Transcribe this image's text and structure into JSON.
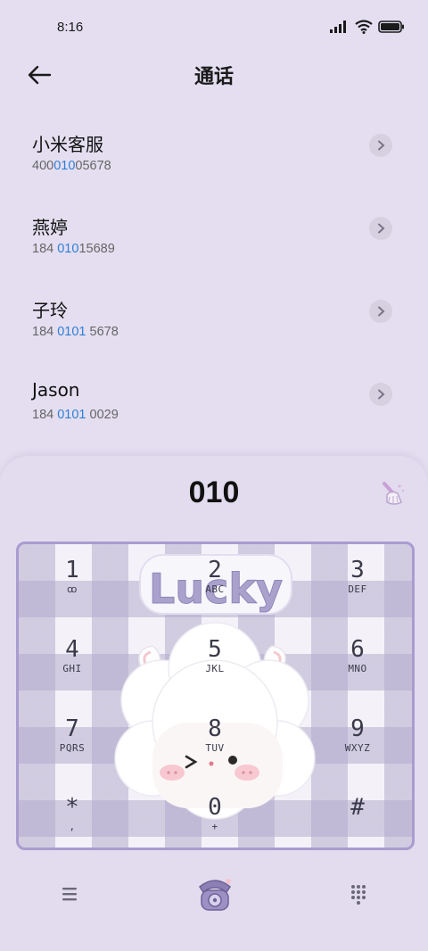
{
  "status": {
    "time": "8:16",
    "battery_icon": "battery-icon",
    "wifi_icon": "wifi-icon",
    "signal_icon": "signal-icon"
  },
  "header": {
    "title": "通话",
    "back_icon": "back-arrow-icon"
  },
  "results": [
    {
      "name": "小米客服",
      "number_pre": "400",
      "number_hl": "010",
      "number_post": "05678"
    },
    {
      "name": "燕婷",
      "number_pre": "184 ",
      "number_hl": "010",
      "number_post": "15689"
    },
    {
      "name": "子玲",
      "number_pre": "184 ",
      "number_hl": "0101",
      "number_post": " 5678"
    },
    {
      "name": "Jason",
      "number_pre": "184 ",
      "number_hl": "0101",
      "number_post": " 0029"
    }
  ],
  "dialer": {
    "input_value": "010",
    "theme_word": "Lucky",
    "keys": [
      {
        "digit": "1",
        "letters": "ꝏ"
      },
      {
        "digit": "2",
        "letters": "ABC"
      },
      {
        "digit": "3",
        "letters": "DEF"
      },
      {
        "digit": "4",
        "letters": "GHI"
      },
      {
        "digit": "5",
        "letters": "JKL"
      },
      {
        "digit": "6",
        "letters": "MNO"
      },
      {
        "digit": "7",
        "letters": "PQRS"
      },
      {
        "digit": "8",
        "letters": "TUV"
      },
      {
        "digit": "9",
        "letters": "WXYZ"
      },
      {
        "digit": "*",
        "letters": ","
      },
      {
        "digit": "0",
        "letters": "+"
      },
      {
        "digit": "#",
        "letters": ""
      }
    ]
  },
  "colors": {
    "background": "#e4def0",
    "highlight": "#2f7fd6",
    "keypad_border": "#a89cd0"
  }
}
